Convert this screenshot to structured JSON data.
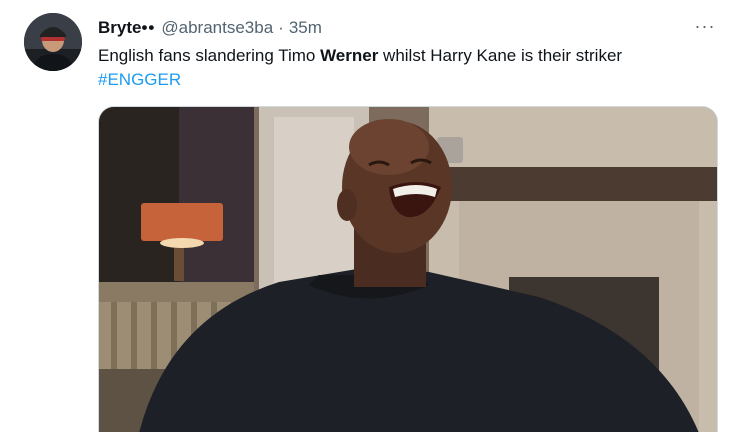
{
  "tweet": {
    "author": {
      "display_name": "Bryte",
      "badge": "••",
      "handle": "@abrantse3ba",
      "separator": "·",
      "time": "35m",
      "avatar_icon": "profile-photo"
    },
    "more_icon": "more-options-icon",
    "more_label": "···",
    "text": {
      "part1": "English fans slandering Timo ",
      "bold": "Werner",
      "part2": " whilst Harry Kane is their striker"
    },
    "hashtag": "#ENGGER",
    "media": {
      "kind": "photo",
      "icon": "laughing-man-photo"
    }
  },
  "colors": {
    "link": "#1d9bf0",
    "secondary_text": "#536471",
    "primary_text": "#0f1419",
    "border": "#cfd9de"
  }
}
